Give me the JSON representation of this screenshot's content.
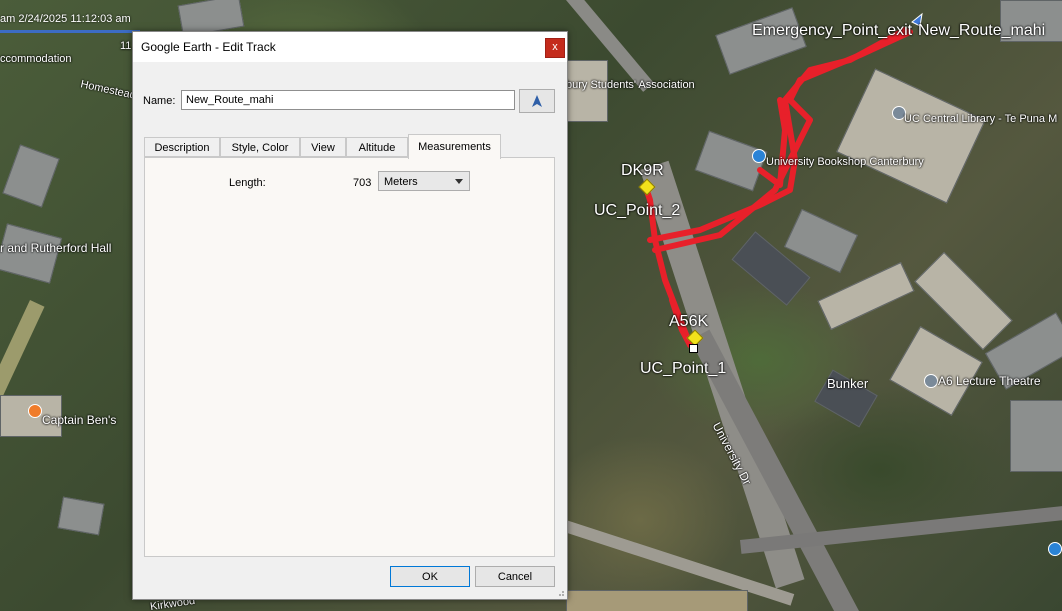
{
  "map": {
    "timestamp": "am 2/24/2025  11:12:03 am",
    "scale_fragment": "11",
    "labels": {
      "accommodation": "ccommodation",
      "students_assoc": "bury Students' Association",
      "library": "UC Central Library - Te Puna M",
      "bookshop": "University Bookshop Canterbury",
      "rutherford": "r and Rutherford Hall",
      "captain_bens": "Captain Ben's",
      "bunker": "Bunker",
      "lecture": "A6 Lecture Theatre",
      "university_dr": "University Dr",
      "kirkwood": "Kirkwood",
      "homestead": "Homestead"
    },
    "placemarks": {
      "emergency": "Emergency_Point_exit",
      "route": "New_Route_mahi",
      "dk9r": "DK9R",
      "uc2": "UC_Point_2",
      "a56k": "A56K",
      "uc1": "UC_Point_1"
    },
    "route_color": "#e8202a"
  },
  "dialog": {
    "title": "Google Earth - Edit Track",
    "close": "x",
    "name_label": "Name:",
    "name_value": "New_Route_mahi",
    "tabs": [
      "Description",
      "Style, Color",
      "View",
      "Altitude",
      "Measurements"
    ],
    "active_tab": "Measurements",
    "measurements": {
      "length_label": "Length:",
      "length_value": "703",
      "unit": "Meters"
    },
    "ok": "OK",
    "cancel": "Cancel"
  }
}
